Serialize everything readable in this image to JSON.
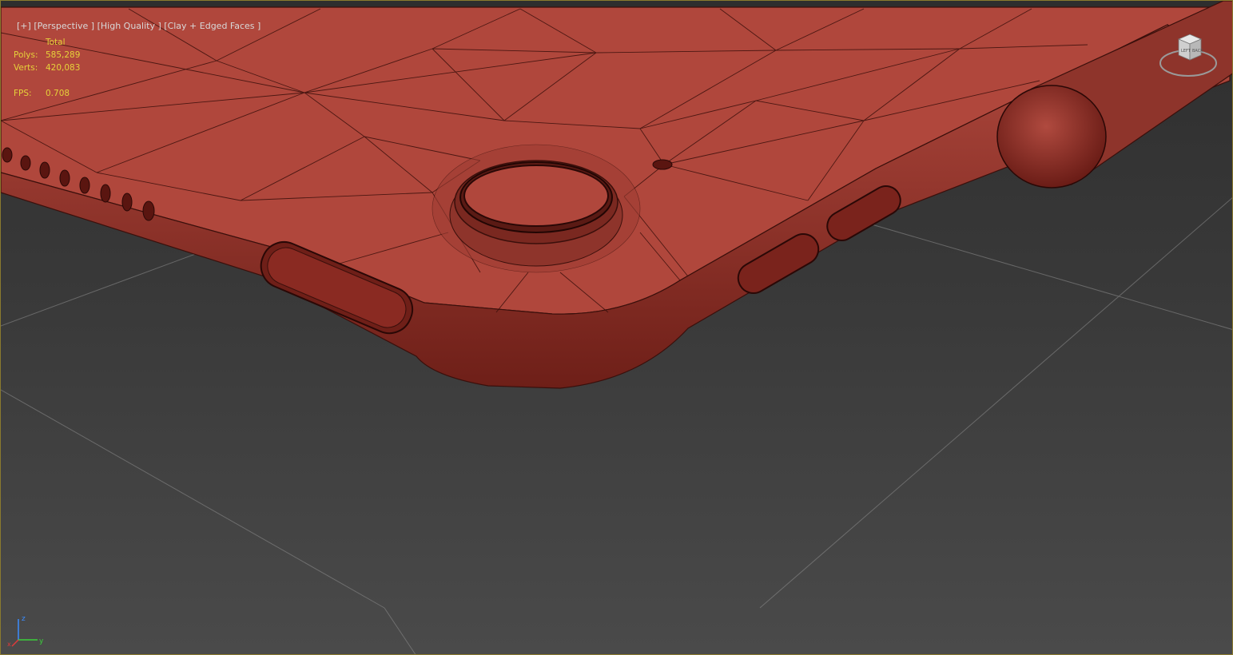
{
  "viewport": {
    "label_parts": [
      "[+]",
      "[Perspective ]",
      "[High Quality ]",
      "[Clay + Edged Faces ]"
    ],
    "border_color": "#8a7a2e"
  },
  "stats": {
    "header": "Total",
    "polys_label": "Polys:",
    "polys_value": "585,289",
    "verts_label": "Verts:",
    "verts_value": "420,083",
    "fps_label": "FPS:",
    "fps_value": "0.708",
    "color": "#e6d23a"
  },
  "viewcube": {
    "left_face": "LEFT",
    "back_face": "BACK"
  },
  "axis": {
    "x": "x",
    "y": "y",
    "z": "z"
  },
  "colors": {
    "model_face": "#b0473c",
    "model_shadow": "#7a231c",
    "wire": "#3a0f0b",
    "grid": "#8f8f8f",
    "background": "#3a3a3a"
  }
}
